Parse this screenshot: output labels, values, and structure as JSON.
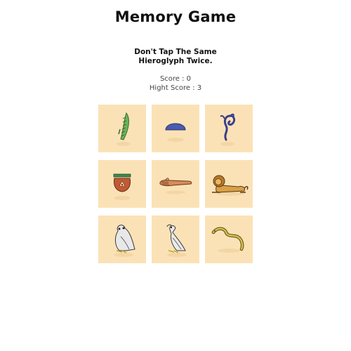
{
  "header": {
    "title": "Memory Game"
  },
  "instructions": {
    "line1": "Don't Tap The Same",
    "line2": "Hieroglyph Twice."
  },
  "scoreboard": {
    "score_text": "Score : 0",
    "high_score_text": "Hight Score : 3"
  },
  "board": {
    "rows": 3,
    "columns": 3,
    "tiles": [
      {
        "glyph": "reed-feather-icon"
      },
      {
        "glyph": "bread-loaf-icon"
      },
      {
        "glyph": "horned-viper-icon"
      },
      {
        "glyph": "basket-pot-icon"
      },
      {
        "glyph": "arm-hand-icon"
      },
      {
        "glyph": "lion-icon"
      },
      {
        "glyph": "owl-icon"
      },
      {
        "glyph": "vulture-icon"
      },
      {
        "glyph": "snake-icon"
      }
    ],
    "colors": {
      "tile_background": "#fbe2b6",
      "green": "#6bb35a",
      "blue": "#4a5bb0",
      "terracotta": "#c05a34",
      "ochre": "#d9a045",
      "outline": "#3a2c22"
    }
  }
}
